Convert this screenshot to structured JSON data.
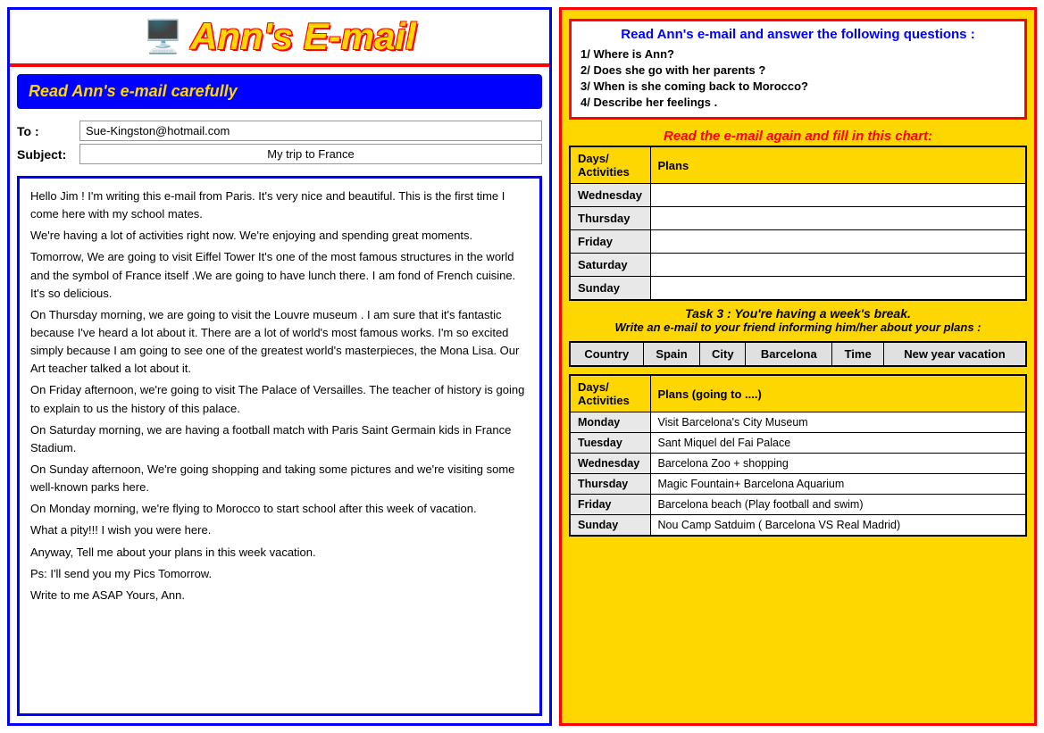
{
  "left": {
    "title": "Ann's E-mail",
    "banner": "Read Ann's e-mail carefully",
    "to_label": "To :",
    "to_value": "Sue-Kingston@hotmail.com",
    "subject_label": "Subject:",
    "subject_value": "My trip to France",
    "body": [
      "Hello Jim ! I'm writing this e-mail  from Paris. It's very nice and beautiful. This is  the first time I come here with my school mates.",
      "We're having a lot of activities right now. We're  enjoying  and spending great moments.",
      "        Tomorrow, We are going to visit Eiffel Tower It's one of the most famous structures in the world and  the symbol of France itself .We are going to have lunch there. I am fond of French cuisine. It's so delicious.",
      "        On Thursday morning, we are going to visit the Louvre museum . I am sure that it's fantastic because I've heard a lot about it. There are a lot of world's  most famous  works. I'm so excited simply because I am going to see one of the greatest world's masterpieces, the  Mona Lisa. Our Art teacher talked a lot about it.",
      "        On Friday afternoon, we're going to visit The Palace of Versailles. The teacher of history is going to explain to us the history of this palace.",
      "        On Saturday morning, we are having a football match with Paris Saint Germain kids in France Stadium.",
      "        On Sunday afternoon, We're going shopping and taking some pictures  and we're visiting some well-known parks here.",
      "        On Monday morning, we're flying to Morocco to start school  after this week of  vacation.",
      "        What a pity!!!  I wish you were here.",
      "        Anyway, Tell me about your plans in this week vacation.",
      "Ps: I'll send you my Pics Tomorrow.",
      "Write to  me ASAP                                    Yours, Ann."
    ]
  },
  "right": {
    "questions_title": "Read Ann's e-mail and answer the following questions :",
    "questions": [
      "1/  Where is Ann?",
      "2/  Does she go with her parents ?",
      "3/  When is she coming back to Morocco?",
      "4/  Describe her feelings ."
    ],
    "chart_title": "Read the e-mail again and fill in this chart:",
    "chart_headers": [
      "Days/ Activities",
      "Plans"
    ],
    "chart_rows": [
      {
        "day": "Wednesday",
        "plans": ""
      },
      {
        "day": "Thursday",
        "plans": ""
      },
      {
        "day": "Friday",
        "plans": ""
      },
      {
        "day": "Saturday",
        "plans": ""
      },
      {
        "day": "Sunday",
        "plans": ""
      }
    ],
    "task3_line1": "Task 3 : You're having a week's break.",
    "task3_line2": "Write an e-mail to your friend informing him/her  about  your plans :",
    "info_headers": [
      "Country",
      "Spain",
      "City",
      "Barcelona",
      "Time",
      "New year vacation"
    ],
    "plans_table": {
      "headers": [
        "Days/ Activities",
        "Plans (going to ....)"
      ],
      "rows": [
        {
          "day": "Monday",
          "plan": "Visit Barcelona's City Museum"
        },
        {
          "day": "Tuesday",
          "plan": "Sant Miquel del Fai Palace"
        },
        {
          "day": "Wednesday",
          "plan": "Barcelona Zoo + shopping"
        },
        {
          "day": "Thursday",
          "plan": "Magic Fountain+ Barcelona Aquarium"
        },
        {
          "day": "Friday",
          "plan": "Barcelona beach (Play football and swim)"
        },
        {
          "day": "Sunday",
          "plan": "Nou Camp Satduim ( Barcelona VS Real Madrid)"
        }
      ]
    }
  }
}
